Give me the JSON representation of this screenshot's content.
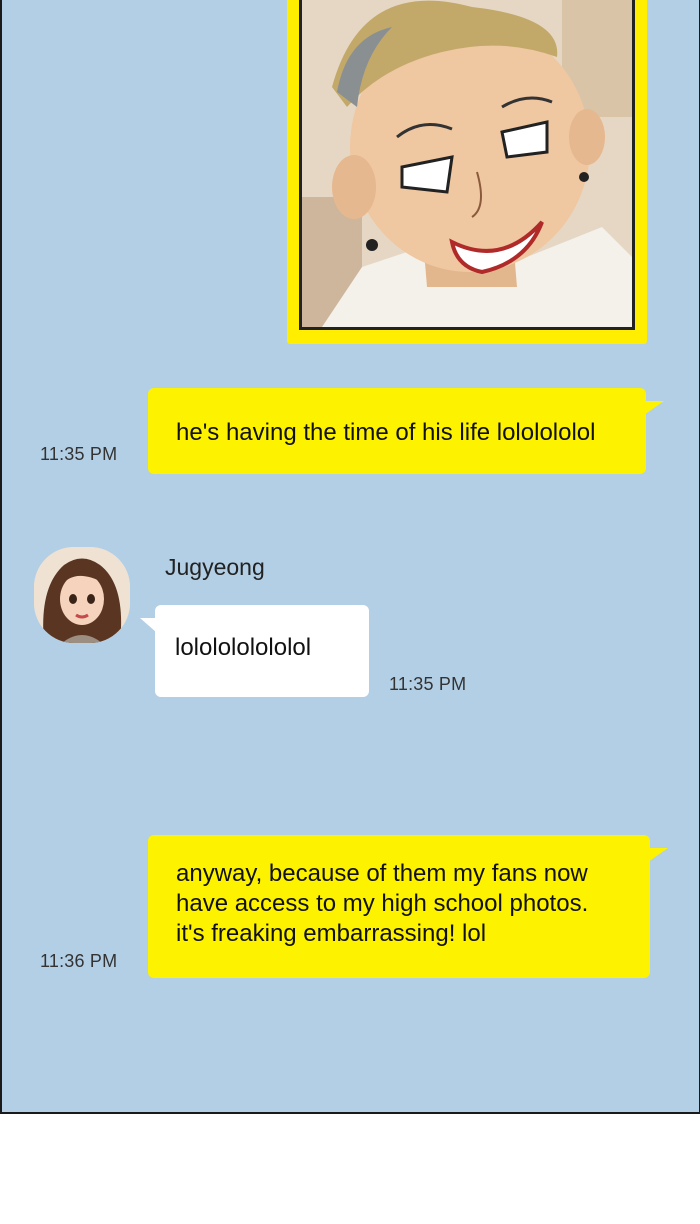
{
  "conversation": {
    "photo": {
      "alt_icon": "shared-photo"
    },
    "messages": [
      {
        "sender": "me",
        "text": "he's having the time of his life lololololol",
        "time": "11:35 PM"
      },
      {
        "sender": "Jugyeong",
        "text": "lololololololol",
        "time": "11:35 PM"
      },
      {
        "sender": "me",
        "lines": [
          "anyway, because of them my fans now",
          "have access to my high school photos.",
          "it's freaking embarrassing! lol"
        ],
        "time": "11:36 PM"
      }
    ]
  },
  "colors": {
    "background": "#b3cfe6",
    "my_bubble": "#fdf200",
    "their_bubble": "#ffffff"
  }
}
